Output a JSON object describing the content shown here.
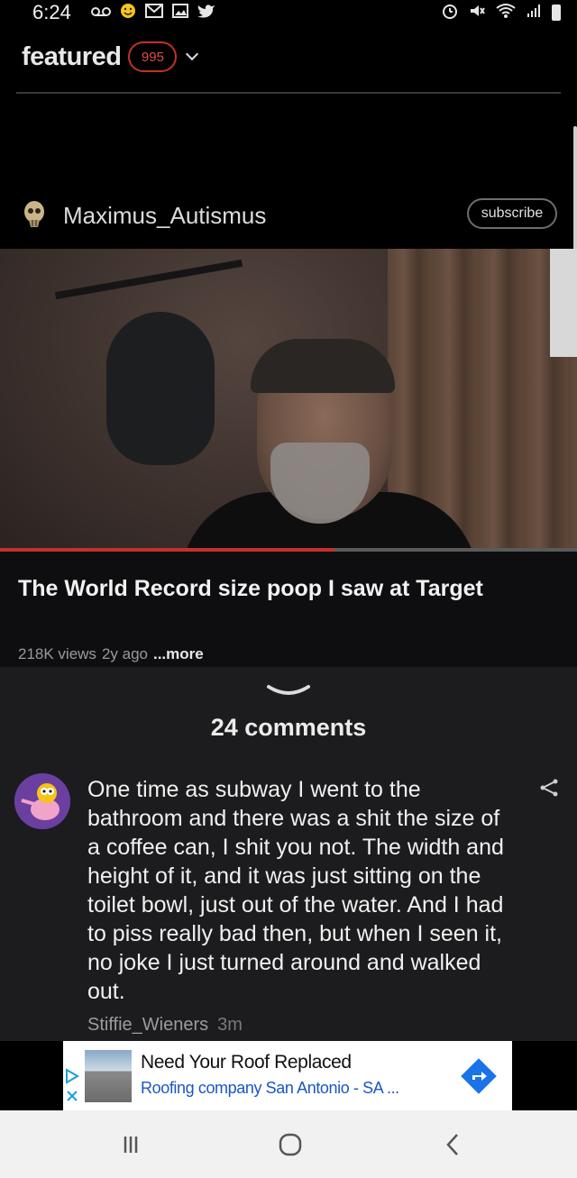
{
  "status_bar": {
    "time": "6:24",
    "left_icons": [
      "voicemail-icon",
      "smiley-icon",
      "gmail-icon",
      "gallery-icon",
      "twitter-icon"
    ],
    "right_icons": [
      "alarm-icon",
      "mute-icon",
      "wifi-icon",
      "signal-icon",
      "battery-icon"
    ]
  },
  "header": {
    "title": "featured",
    "count": "995"
  },
  "channel": {
    "name": "Maximus_Autismus",
    "subscribe_label": "subscribe"
  },
  "video": {
    "progress_fraction": 0.58,
    "title": "The World Record size poop I saw at Target",
    "views": "218K views",
    "age": "2y ago",
    "more_label": "...more"
  },
  "comments": {
    "count_label": "24 comments",
    "items": [
      {
        "text": "One time as subway I went to the bathroom and there was a shit the size of a coffee can, I shit you not. The width and height of it, and it was just sitting on the toilet bowl, just out of the water. And I had to piss really bad then, but when I seen it, no joke I just turned around and walked out.",
        "author": "Stiffie_Wieners",
        "time": "3m"
      }
    ]
  },
  "ad": {
    "title": "Need Your Roof Replaced",
    "subtitle": "Roofing company San Antonio - SA ...",
    "accent": "#1a73e8"
  },
  "colors": {
    "accent_red": "#c4302b",
    "background": "#1c1c1e"
  }
}
